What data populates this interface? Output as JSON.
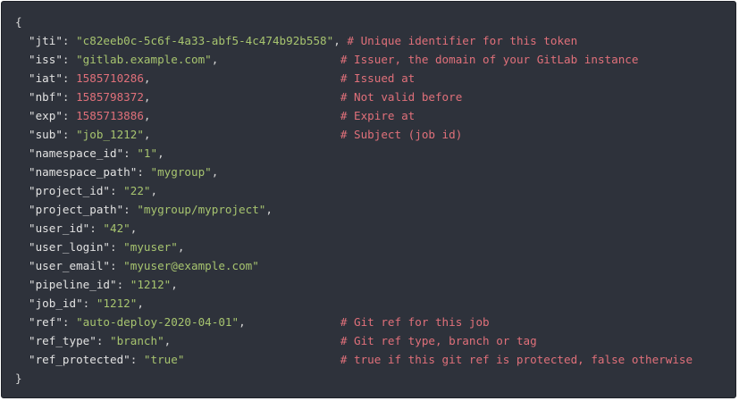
{
  "code": {
    "open_brace": "{",
    "close_brace": "}",
    "lines": [
      {
        "key": "\"jti\"",
        "value": "\"c82eeb0c-5c6f-4a33-abf5-4c474b92b558\"",
        "vtype": "string",
        "pad": "",
        "comment": "# Unique identifier for this token"
      },
      {
        "key": "\"iss\"",
        "value": "\"gitlab.example.com\"",
        "vtype": "string",
        "pad": "                    ",
        "comment": "# Issuer, the domain of your GitLab instance"
      },
      {
        "key": "\"iat\"",
        "value": "1585710286",
        "vtype": "number",
        "pad": "                              ",
        "comment": "# Issued at"
      },
      {
        "key": "\"nbf\"",
        "value": "1585798372",
        "vtype": "number",
        "pad": "                              ",
        "comment": "# Not valid before"
      },
      {
        "key": "\"exp\"",
        "value": "1585713886",
        "vtype": "number",
        "pad": "                              ",
        "comment": "# Expire at"
      },
      {
        "key": "\"sub\"",
        "value": "\"job_1212\"",
        "vtype": "string",
        "pad": "                              ",
        "comment": "# Subject (job id)"
      },
      {
        "key": "\"namespace_id\"",
        "value": "\"1\"",
        "vtype": "string",
        "pad": "",
        "comment": ""
      },
      {
        "key": "\"namespace_path\"",
        "value": "\"mygroup\"",
        "vtype": "string",
        "pad": "",
        "comment": ""
      },
      {
        "key": "\"project_id\"",
        "value": "\"22\"",
        "vtype": "string",
        "pad": "",
        "comment": ""
      },
      {
        "key": "\"project_path\"",
        "value": "\"mygroup/myproject\"",
        "vtype": "string",
        "pad": "",
        "comment": ""
      },
      {
        "key": "\"user_id\"",
        "value": "\"42\"",
        "vtype": "string",
        "pad": "",
        "comment": ""
      },
      {
        "key": "\"user_login\"",
        "value": "\"myuser\"",
        "vtype": "string",
        "pad": "",
        "comment": ""
      },
      {
        "key": "\"user_email\"",
        "value": "\"myuser@example.com\"",
        "vtype": "string",
        "pad": "",
        "comment": "",
        "nocomma": true
      },
      {
        "key": "\"pipeline_id\"",
        "value": "\"1212\"",
        "vtype": "string",
        "pad": "",
        "comment": ""
      },
      {
        "key": "\"job_id\"",
        "value": "\"1212\"",
        "vtype": "string",
        "pad": "",
        "comment": ""
      },
      {
        "key": "\"ref\"",
        "value": "\"auto-deploy-2020-04-01\"",
        "vtype": "string",
        "pad": "                ",
        "comment": "# Git ref for this job"
      },
      {
        "key": "\"ref_type\"",
        "value": "\"branch\"",
        "vtype": "string",
        "pad": "                           ",
        "comment": "# Git ref type, branch or tag"
      },
      {
        "key": "\"ref_protected\"",
        "value": "\"true\"",
        "vtype": "string",
        "pad": "                         ",
        "comment": "# true if this git ref is protected, false otherwise",
        "nocomma": true
      }
    ]
  },
  "colors": {
    "background": "#2e323b",
    "string": "#a7c46f",
    "number": "#e0707a",
    "comment": "#e0707a",
    "key": "#e2e2e2"
  }
}
